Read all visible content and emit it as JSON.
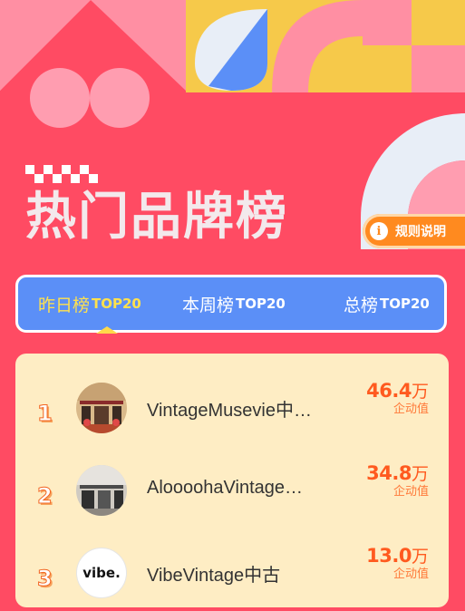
{
  "header": {
    "title": "热门品牌榜",
    "rules_label": "规则说明",
    "rules_icon": "info-icon"
  },
  "tabs": [
    {
      "label": "昨日榜",
      "suffix": "TOP20",
      "active": true
    },
    {
      "label": "本周榜",
      "suffix": "TOP20",
      "active": false
    },
    {
      "label": "总榜",
      "suffix": "TOP20",
      "active": false
    }
  ],
  "list": {
    "items": [
      {
        "rank": "1",
        "name": "VintageMusevie中…",
        "value": "46.4",
        "unit": "万",
        "metric": "企动值"
      },
      {
        "rank": "2",
        "name": "AloooohaVintage…",
        "value": "34.8",
        "unit": "万",
        "metric": "企动值"
      },
      {
        "rank": "3",
        "name": "VibeVintage中古",
        "value": "13.0",
        "unit": "万",
        "metric": "企动值",
        "logo_text": "vibe."
      }
    ]
  },
  "colors": {
    "background": "#ff4b63",
    "tab_bar": "#5b8ff7",
    "active_tab": "#ffe14d",
    "list_bg": "#feedc4",
    "score": "#ff5a1f",
    "rules_button": "#ff8a1f"
  }
}
